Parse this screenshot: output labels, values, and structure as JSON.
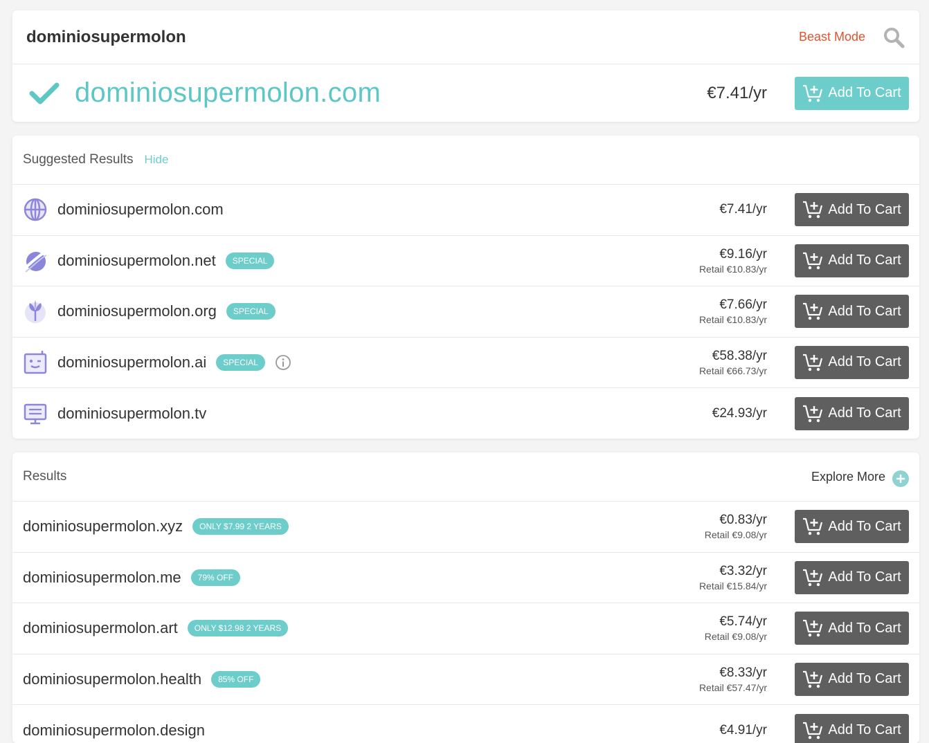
{
  "search": {
    "term": "dominiosupermolon",
    "beast_mode": "Beast Mode",
    "icon": "search-icon"
  },
  "main_result": {
    "domain": "dominiosupermolon.com",
    "price": "€7.41/yr",
    "button": "Add To Cart",
    "icon": "check-icon"
  },
  "suggested": {
    "title": "Suggested Results",
    "hide": "Hide",
    "items": [
      {
        "domain": "dominiosupermolon.com",
        "badge": "",
        "price": "€7.41/yr",
        "retail": "",
        "button": "Add To Cart",
        "icon": "globe-icon"
      },
      {
        "domain": "dominiosupermolon.net",
        "badge": "SPECIAL",
        "price": "€9.16/yr",
        "retail": "Retail €10.83/yr",
        "button": "Add To Cart",
        "icon": "planet-icon"
      },
      {
        "domain": "dominiosupermolon.org",
        "badge": "SPECIAL",
        "price": "€7.66/yr",
        "retail": "Retail €10.83/yr",
        "button": "Add To Cart",
        "icon": "plant-icon"
      },
      {
        "domain": "dominiosupermolon.ai",
        "badge": "SPECIAL",
        "price": "€58.38/yr",
        "retail": "Retail €66.73/yr",
        "button": "Add To Cart",
        "icon": "robot-icon"
      },
      {
        "domain": "dominiosupermolon.tv",
        "badge": "",
        "price": "€24.93/yr",
        "retail": "",
        "button": "Add To Cart",
        "icon": "monitor-icon"
      }
    ]
  },
  "results": {
    "title": "Results",
    "explore": "Explore More",
    "items": [
      {
        "domain": "dominiosupermolon.xyz",
        "badge": "ONLY $7.99 2 YEARS",
        "price": "€0.83/yr",
        "retail": "Retail €9.08/yr",
        "button": "Add To Cart"
      },
      {
        "domain": "dominiosupermolon.me",
        "badge": "79% OFF",
        "price": "€3.32/yr",
        "retail": "Retail €15.84/yr",
        "button": "Add To Cart"
      },
      {
        "domain": "dominiosupermolon.art",
        "badge": "ONLY $12.98 2 YEARS",
        "price": "€5.74/yr",
        "retail": "Retail €9.08/yr",
        "button": "Add To Cart"
      },
      {
        "domain": "dominiosupermolon.health",
        "badge": "85% OFF",
        "price": "€8.33/yr",
        "retail": "Retail €57.47/yr",
        "button": "Add To Cart"
      },
      {
        "domain": "dominiosupermolon.design",
        "badge": "",
        "price": "€4.91/yr",
        "retail": "",
        "button": "Add To Cart"
      }
    ]
  },
  "colors": {
    "accent": "#6dcdcb",
    "beast": "#e2532e",
    "button_gray": "#5f5f60",
    "icon_purple": "#8b86d9"
  }
}
